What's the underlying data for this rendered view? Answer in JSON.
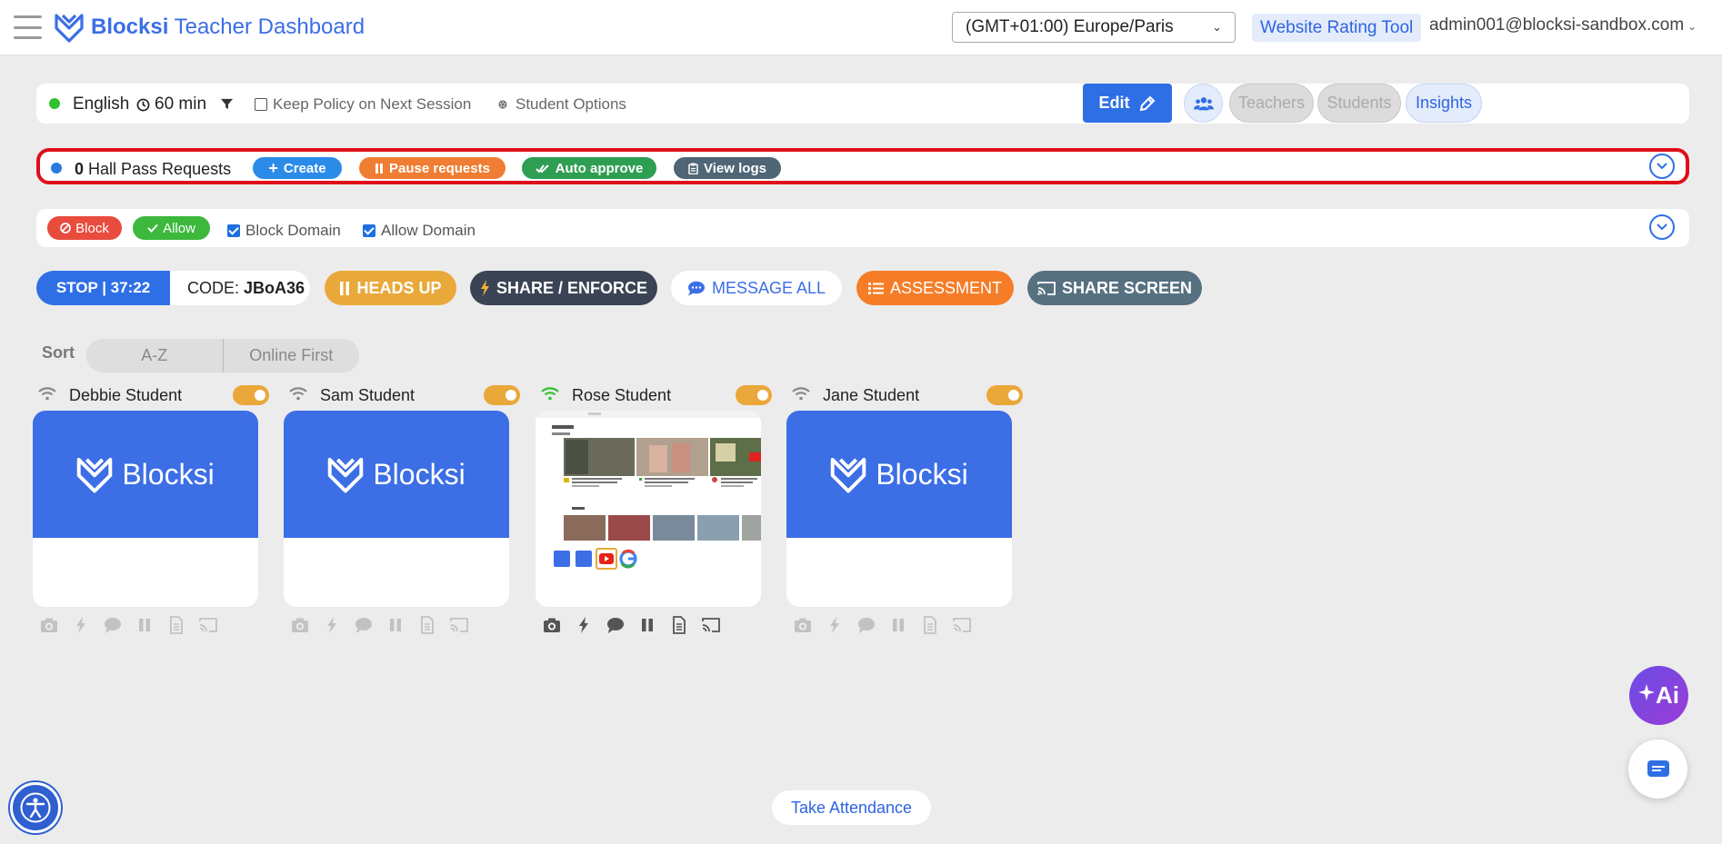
{
  "header": {
    "brand": "Blocksi",
    "title_rest": "Teacher Dashboard",
    "timezone": "(GMT+01:00) Europe/Paris",
    "rating_tool": "Website Rating Tool",
    "user_email": "admin001@blocksi-sandbox.com"
  },
  "policy": {
    "language": "English",
    "duration": "60 min",
    "keep_policy": "Keep Policy on Next Session",
    "keep_policy_checked": false,
    "student_options": "Student Options",
    "edit": "Edit",
    "teachers": "Teachers",
    "students": "Students",
    "insights": "Insights"
  },
  "hall_pass": {
    "count": "0",
    "label": "Hall Pass Requests",
    "create": "Create",
    "pause": "Pause requests",
    "auto_approve": "Auto approve",
    "view_logs": "View logs"
  },
  "domains": {
    "block": "Block",
    "allow": "Allow",
    "block_domain": "Block Domain",
    "allow_domain": "Allow Domain",
    "block_domain_checked": true,
    "allow_domain_checked": true
  },
  "session": {
    "stop": "STOP | 37:22",
    "code_label": "CODE:",
    "code": "JBoA36",
    "heads_up": "HEADS UP",
    "share_enforce": "SHARE / ENFORCE",
    "message_all": "MESSAGE ALL",
    "assessment": "ASSESSMENT",
    "share_screen": "SHARE SCREEN"
  },
  "sort": {
    "label": "Sort",
    "options": [
      "A-Z",
      "Online First"
    ]
  },
  "students": [
    {
      "name": "Debbie Student",
      "online": false,
      "screen": "placeholder",
      "placeholder_text": "Blocksi"
    },
    {
      "name": "Sam Student",
      "online": false,
      "screen": "placeholder",
      "placeholder_text": "Blocksi"
    },
    {
      "name": "Rose Student",
      "online": true,
      "screen": "screenshot",
      "placeholder_text": ""
    },
    {
      "name": "Jane Student",
      "online": false,
      "screen": "placeholder",
      "placeholder_text": "Blocksi"
    }
  ],
  "footer": {
    "take_attendance": "Take Attendance",
    "ai_label": "Ai"
  },
  "colors": {
    "primary": "#2f6fe6",
    "online": "#2fc22f",
    "toggle": "#eaa83a",
    "highlight": "#e00d1a",
    "create": "#2b8be8",
    "pause": "#ef7d33",
    "auto_approve": "#2e9e52",
    "view_logs": "#4e6676",
    "block": "#e84c3d",
    "allow": "#3cb83c",
    "heads_up": "#e8a93a",
    "share_enforce": "#3a4454",
    "assessment": "#f57d27",
    "share_screen": "#567080"
  }
}
